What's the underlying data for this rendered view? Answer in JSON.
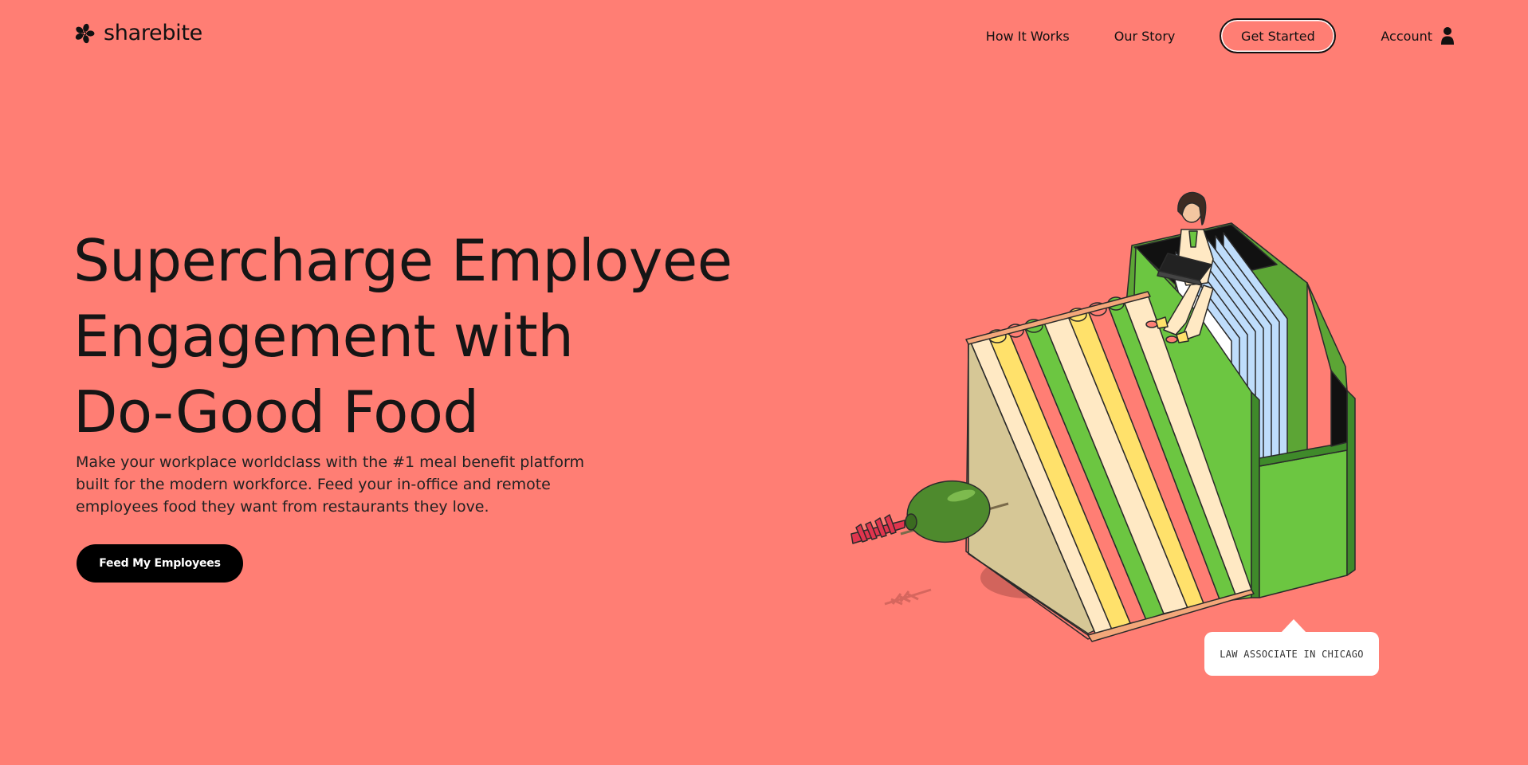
{
  "brand": {
    "name": "sharebite",
    "logo_icon": "flower-logo-icon"
  },
  "nav": {
    "links": [
      "How It Works",
      "Our Story"
    ],
    "cta_label": "Get Started",
    "account_label": "Account",
    "account_icon": "person-icon"
  },
  "hero": {
    "title_lines": [
      "Supercharge Employee",
      "Engagement with",
      "Do-Good Food"
    ],
    "description": "Make your workplace worldclass with the #1 meal benefit platform built for the modern workforce. Feed your in-office and remote employees food they want from restaurants they love.",
    "button_label": "Feed My Employees"
  },
  "illustration": {
    "subject": "sandwich-with-olive-and-person-on-laptop",
    "caption": "LAW ASSOCIATE IN CHICAGO"
  },
  "colors": {
    "background": "#FF7E74",
    "text": "#111111",
    "button_bg": "#000000",
    "button_text": "#FFFFFF",
    "lettuce": "#6CC641",
    "bread": "#FFE9C4",
    "mustard": "#FFE16B",
    "tomato": "#FF7E74",
    "paper": "#BFDDFB"
  }
}
